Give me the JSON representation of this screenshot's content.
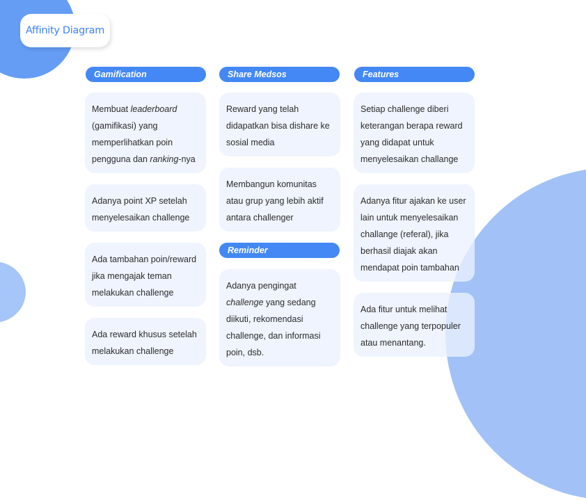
{
  "title": "Affinity Diagram",
  "colors": {
    "accent": "#4388f5",
    "card_background": "#eef3fe",
    "circle_dark": "#659df5",
    "circle_light": "#a2c2f7",
    "title_text": "#3b82f6"
  },
  "groups": [
    {
      "label": "Gamification",
      "notes": [
        {
          "parts": [
            {
              "t": "Membuat "
            },
            {
              "t": "leaderboard",
              "i": true
            },
            {
              "t": " (gamifikasi) yang memperlihatkan poin pengguna dan "
            },
            {
              "t": "ranking",
              "i": true
            },
            {
              "t": "-nya"
            }
          ]
        },
        {
          "parts": [
            {
              "t": "Adanya point XP setelah menyelesaikan challenge"
            }
          ]
        },
        {
          "parts": [
            {
              "t": "Ada tambahan poin/reward jika mengajak teman melakukan challenge"
            }
          ]
        },
        {
          "parts": [
            {
              "t": "Ada reward khusus setelah melakukan challenge"
            }
          ]
        }
      ]
    },
    {
      "label": "Share Medsos",
      "notes": [
        {
          "parts": [
            {
              "t": "Reward yang telah didapatkan bisa dishare ke sosial media"
            }
          ]
        },
        {
          "parts": [
            {
              "t": "Membangun komunitas atau grup yang lebih aktif antara challenger"
            }
          ]
        }
      ]
    },
    {
      "label": "Reminder",
      "notes": [
        {
          "parts": [
            {
              "t": "Adanya pengingat "
            },
            {
              "t": "challenge",
              "i": true
            },
            {
              "t": " yang sedang diikuti, rekomendasi challenge, dan informasi poin, dsb."
            }
          ]
        }
      ]
    },
    {
      "label": "Features",
      "notes": [
        {
          "parts": [
            {
              "t": "Setiap challenge diberi keterangan berapa reward yang didapat untuk menyelesaikan challange"
            }
          ]
        },
        {
          "parts": [
            {
              "t": "Adanya fitur ajakan ke user lain untuk menyelesaikan challange (referal), jika berhasil diajak akan mendapat poin tambahan"
            }
          ]
        },
        {
          "parts": [
            {
              "t": "Ada fitur untuk melihat challenge yang terpopuler atau menantang."
            }
          ]
        }
      ]
    }
  ]
}
